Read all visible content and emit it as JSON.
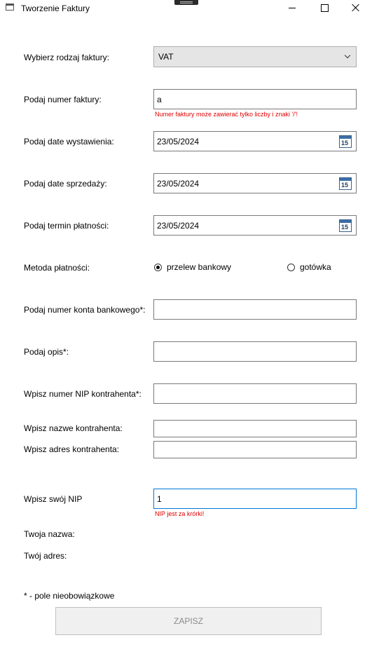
{
  "window": {
    "title": "Tworzenie Faktury"
  },
  "form": {
    "invoice_type": {
      "label": "Wybierz rodzaj faktury:",
      "value": "VAT"
    },
    "invoice_number": {
      "label": "Podaj numer faktury:",
      "value": "a",
      "error": "Numer faktury może zawierać tylko liczby i znaki '/'!"
    },
    "issue_date": {
      "label": "Podaj date wystawienia:",
      "value": "23/05/2024",
      "icon_day": "15"
    },
    "sale_date": {
      "label": "Podaj date sprzedaży:",
      "value": "23/05/2024",
      "icon_day": "15"
    },
    "payment_due": {
      "label": "Podaj termin płatności:",
      "value": "23/05/2024",
      "icon_day": "15"
    },
    "payment_method": {
      "label": "Metoda płatności:",
      "options": [
        "przelew bankowy",
        "gotówka"
      ],
      "selected": "przelew bankowy"
    },
    "bank_account": {
      "label": "Podaj numer konta bankowego*:",
      "value": ""
    },
    "description": {
      "label": "Podaj opis*:",
      "value": ""
    },
    "contractor_nip": {
      "label": "Wpisz numer NIP kontrahenta*:",
      "value": ""
    },
    "contractor_name": {
      "label": "Wpisz nazwe kontrahenta:",
      "value": ""
    },
    "contractor_address": {
      "label": "Wpisz adres kontrahenta:",
      "value": ""
    },
    "own_nip": {
      "label": "Wpisz swój NIP",
      "value": "1",
      "error": "NIP jest za krórki!"
    },
    "own_name": {
      "label": "Twoja nazwa:"
    },
    "own_address": {
      "label": "Twój adres:"
    },
    "optional_note": "* - pole nieobowiązkowe",
    "save_label": "ZAPISZ"
  }
}
